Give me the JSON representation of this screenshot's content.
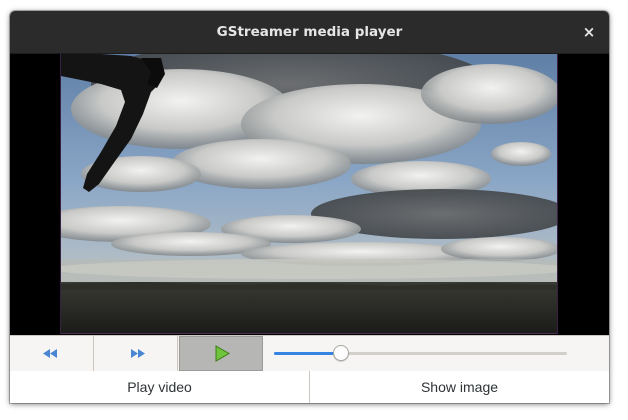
{
  "window": {
    "title": "GStreamer media player",
    "close_glyph": "×"
  },
  "video": {
    "content": "sky-with-clouds-frame"
  },
  "controls": {
    "rewind_icon": "rewind-icon",
    "forward_icon": "fast-forward-icon",
    "play_icon": "play-icon",
    "play_pressed": true,
    "position_fraction": 0.23,
    "accent_color": "#3584e4",
    "play_color": "#4e9a06",
    "seek_color": "#3584e4"
  },
  "buttons": {
    "play_video": "Play video",
    "show_image": "Show image"
  }
}
